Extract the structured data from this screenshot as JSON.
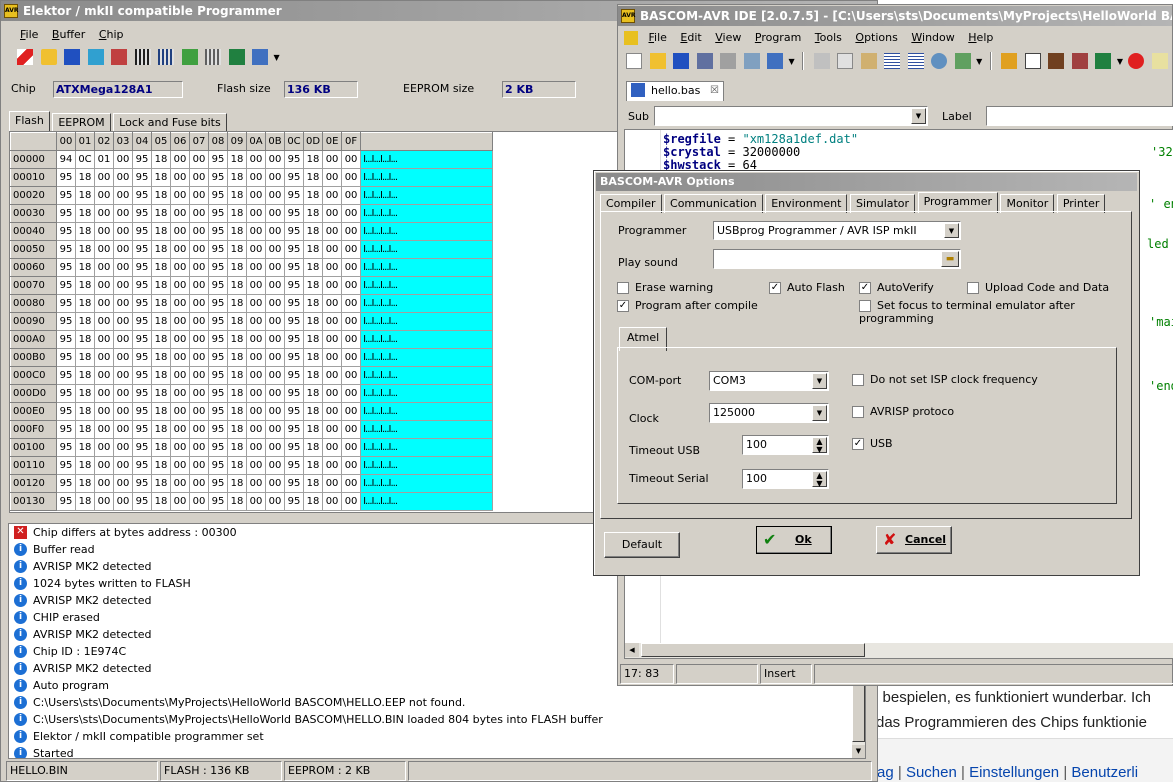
{
  "programmer": {
    "title": "Elektor / mkII compatible Programmer",
    "menu": [
      "File",
      "Buffer",
      "Chip"
    ],
    "chip_label": "Chip",
    "chip_value": "ATXMega128A1",
    "flash_label": "Flash size",
    "flash_value": "136 KB",
    "eeprom_label": "EEPROM size",
    "eeprom_value": "2 KB",
    "tabs": [
      "Flash",
      "EEPROM",
      "Lock and Fuse bits"
    ],
    "hex_columns": [
      "00",
      "01",
      "02",
      "03",
      "04",
      "05",
      "06",
      "07",
      "08",
      "09",
      "0A",
      "0B",
      "0C",
      "0D",
      "0E",
      "0F"
    ],
    "hex_rows": [
      {
        "addr": "00000",
        "bytes": [
          "94",
          "0C",
          "01",
          "00",
          "95",
          "18",
          "00",
          "00",
          "95",
          "18",
          "00",
          "00",
          "95",
          "18",
          "00",
          "00"
        ],
        "ascii": "I...I...I...I..."
      },
      {
        "addr": "00010",
        "bytes": [
          "95",
          "18",
          "00",
          "00",
          "95",
          "18",
          "00",
          "00",
          "95",
          "18",
          "00",
          "00",
          "95",
          "18",
          "00",
          "00"
        ],
        "ascii": "I...I...I...I..."
      },
      {
        "addr": "00020",
        "bytes": [
          "95",
          "18",
          "00",
          "00",
          "95",
          "18",
          "00",
          "00",
          "95",
          "18",
          "00",
          "00",
          "95",
          "18",
          "00",
          "00"
        ],
        "ascii": "I...I...I...I..."
      },
      {
        "addr": "00030",
        "bytes": [
          "95",
          "18",
          "00",
          "00",
          "95",
          "18",
          "00",
          "00",
          "95",
          "18",
          "00",
          "00",
          "95",
          "18",
          "00",
          "00"
        ],
        "ascii": "I...I...I...I..."
      },
      {
        "addr": "00040",
        "bytes": [
          "95",
          "18",
          "00",
          "00",
          "95",
          "18",
          "00",
          "00",
          "95",
          "18",
          "00",
          "00",
          "95",
          "18",
          "00",
          "00"
        ],
        "ascii": "I...I...I...I..."
      },
      {
        "addr": "00050",
        "bytes": [
          "95",
          "18",
          "00",
          "00",
          "95",
          "18",
          "00",
          "00",
          "95",
          "18",
          "00",
          "00",
          "95",
          "18",
          "00",
          "00"
        ],
        "ascii": "I...I...I...I..."
      },
      {
        "addr": "00060",
        "bytes": [
          "95",
          "18",
          "00",
          "00",
          "95",
          "18",
          "00",
          "00",
          "95",
          "18",
          "00",
          "00",
          "95",
          "18",
          "00",
          "00"
        ],
        "ascii": "I...I...I...I..."
      },
      {
        "addr": "00070",
        "bytes": [
          "95",
          "18",
          "00",
          "00",
          "95",
          "18",
          "00",
          "00",
          "95",
          "18",
          "00",
          "00",
          "95",
          "18",
          "00",
          "00"
        ],
        "ascii": "I...I...I...I..."
      },
      {
        "addr": "00080",
        "bytes": [
          "95",
          "18",
          "00",
          "00",
          "95",
          "18",
          "00",
          "00",
          "95",
          "18",
          "00",
          "00",
          "95",
          "18",
          "00",
          "00"
        ],
        "ascii": "I...I...I...I..."
      },
      {
        "addr": "00090",
        "bytes": [
          "95",
          "18",
          "00",
          "00",
          "95",
          "18",
          "00",
          "00",
          "95",
          "18",
          "00",
          "00",
          "95",
          "18",
          "00",
          "00"
        ],
        "ascii": "I...I...I...I..."
      },
      {
        "addr": "000A0",
        "bytes": [
          "95",
          "18",
          "00",
          "00",
          "95",
          "18",
          "00",
          "00",
          "95",
          "18",
          "00",
          "00",
          "95",
          "18",
          "00",
          "00"
        ],
        "ascii": "I...I...I...I..."
      },
      {
        "addr": "000B0",
        "bytes": [
          "95",
          "18",
          "00",
          "00",
          "95",
          "18",
          "00",
          "00",
          "95",
          "18",
          "00",
          "00",
          "95",
          "18",
          "00",
          "00"
        ],
        "ascii": "I...I...I...I..."
      },
      {
        "addr": "000C0",
        "bytes": [
          "95",
          "18",
          "00",
          "00",
          "95",
          "18",
          "00",
          "00",
          "95",
          "18",
          "00",
          "00",
          "95",
          "18",
          "00",
          "00"
        ],
        "ascii": "I...I...I...I..."
      },
      {
        "addr": "000D0",
        "bytes": [
          "95",
          "18",
          "00",
          "00",
          "95",
          "18",
          "00",
          "00",
          "95",
          "18",
          "00",
          "00",
          "95",
          "18",
          "00",
          "00"
        ],
        "ascii": "I...I...I...I..."
      },
      {
        "addr": "000E0",
        "bytes": [
          "95",
          "18",
          "00",
          "00",
          "95",
          "18",
          "00",
          "00",
          "95",
          "18",
          "00",
          "00",
          "95",
          "18",
          "00",
          "00"
        ],
        "ascii": "I...I...I...I..."
      },
      {
        "addr": "000F0",
        "bytes": [
          "95",
          "18",
          "00",
          "00",
          "95",
          "18",
          "00",
          "00",
          "95",
          "18",
          "00",
          "00",
          "95",
          "18",
          "00",
          "00"
        ],
        "ascii": "I...I...I...I..."
      },
      {
        "addr": "00100",
        "bytes": [
          "95",
          "18",
          "00",
          "00",
          "95",
          "18",
          "00",
          "00",
          "95",
          "18",
          "00",
          "00",
          "95",
          "18",
          "00",
          "00"
        ],
        "ascii": "I...I...I...I..."
      },
      {
        "addr": "00110",
        "bytes": [
          "95",
          "18",
          "00",
          "00",
          "95",
          "18",
          "00",
          "00",
          "95",
          "18",
          "00",
          "00",
          "95",
          "18",
          "00",
          "00"
        ],
        "ascii": "I...I...I...I..."
      },
      {
        "addr": "00120",
        "bytes": [
          "95",
          "18",
          "00",
          "00",
          "95",
          "18",
          "00",
          "00",
          "95",
          "18",
          "00",
          "00",
          "95",
          "18",
          "00",
          "00"
        ],
        "ascii": "I...I...I...I..."
      },
      {
        "addr": "00130",
        "bytes": [
          "95",
          "18",
          "00",
          "00",
          "95",
          "18",
          "00",
          "00",
          "95",
          "18",
          "00",
          "00",
          "95",
          "18",
          "00",
          "00"
        ],
        "ascii": "I...I...I...I..."
      }
    ],
    "log": [
      {
        "type": "error",
        "text": "Chip differs at bytes address : 00300"
      },
      {
        "type": "info",
        "text": "Buffer read"
      },
      {
        "type": "info",
        "text": "AVRISP MK2 detected"
      },
      {
        "type": "info",
        "text": "1024 bytes written to FLASH"
      },
      {
        "type": "info",
        "text": "AVRISP MK2 detected"
      },
      {
        "type": "info",
        "text": "CHIP erased"
      },
      {
        "type": "info",
        "text": "AVRISP MK2 detected"
      },
      {
        "type": "info",
        "text": "Chip ID : 1E974C"
      },
      {
        "type": "info",
        "text": "AVRISP MK2 detected"
      },
      {
        "type": "info",
        "text": "Auto program"
      },
      {
        "type": "info",
        "text": "C:\\Users\\sts\\Documents\\MyProjects\\HelloWorld BASCOM\\HELLO.EEP not found."
      },
      {
        "type": "info",
        "text": "C:\\Users\\sts\\Documents\\MyProjects\\HelloWorld BASCOM\\HELLO.BIN loaded 804 bytes into FLASH buffer"
      },
      {
        "type": "info",
        "text": "Elektor / mkII compatible programmer set"
      },
      {
        "type": "info",
        "text": "Started"
      }
    ],
    "status": [
      "HELLO.BIN",
      "FLASH : 136 KB",
      "EEPROM : 2 KB"
    ]
  },
  "ide": {
    "title": "BASCOM-AVR IDE [2.0.7.5] - [C:\\Users\\sts\\Documents\\MyProjects\\HelloWorld BASCOM\\hello.b",
    "menu": [
      "File",
      "Edit",
      "View",
      "Program",
      "Tools",
      "Options",
      "Window",
      "Help"
    ],
    "doc_tab": "hello.bas",
    "sub_label": "Sub",
    "label_label": "Label",
    "code_lines": [
      {
        "kw": "$regfile",
        "op": " = ",
        "val": "\"xm128a1def.dat\"",
        "tail": ""
      },
      {
        "kw": "$crystal",
        "op": " = ",
        "val": "32000000",
        "tail": "'32"
      },
      {
        "kw": "$hwstack",
        "op": " = ",
        "val": "64",
        "tail": ""
      }
    ],
    "side_comments": [
      "' en",
      "led",
      "'mai",
      "'end"
    ],
    "status": [
      "17: 83",
      "",
      "Insert"
    ]
  },
  "options": {
    "title": "BASCOM-AVR Options",
    "tabs": [
      "Compiler",
      "Communication",
      "Environment",
      "Simulator",
      "Programmer",
      "Monitor",
      "Printer"
    ],
    "active_tab": "Programmer",
    "programmer_label": "Programmer",
    "programmer_value": "USBprog Programmer / AVR ISP mkII",
    "play_sound_label": "Play sound",
    "play_sound_value": "",
    "checks": [
      {
        "label": "Erase warning",
        "checked": false
      },
      {
        "label": "Auto Flash",
        "checked": true
      },
      {
        "label": "AutoVerify",
        "checked": true
      },
      {
        "label": "Upload Code and Data",
        "checked": false
      },
      {
        "label": "Program after compile",
        "checked": true
      },
      {
        "label": "Set focus to terminal emulator after programming",
        "checked": false
      }
    ],
    "atmel_tab": "Atmel",
    "com_port_label": "COM-port",
    "com_port_value": "COM3",
    "clock_label": "Clock",
    "clock_value": "125000",
    "timeout_usb_label": "Timeout USB",
    "timeout_usb_value": "100",
    "timeout_serial_label": "Timeout Serial",
    "timeout_serial_value": "100",
    "atmel_checks": [
      {
        "label": "Do not set ISP clock frequency",
        "checked": false
      },
      {
        "label": "AVRISP protoco",
        "checked": false
      },
      {
        "label": "USB",
        "checked": true
      }
    ],
    "default_button": "Default",
    "ok_button": "Ok",
    "cancel_button": "Cancel"
  },
  "browser": {
    "line1": "e bespielen, es funktioniert wunderbar. Ich",
    "line2": "das Programmieren des Chips funktionie",
    "links": [
      "rag",
      "Suchen",
      "Einstellungen",
      "Benutzerli"
    ]
  }
}
